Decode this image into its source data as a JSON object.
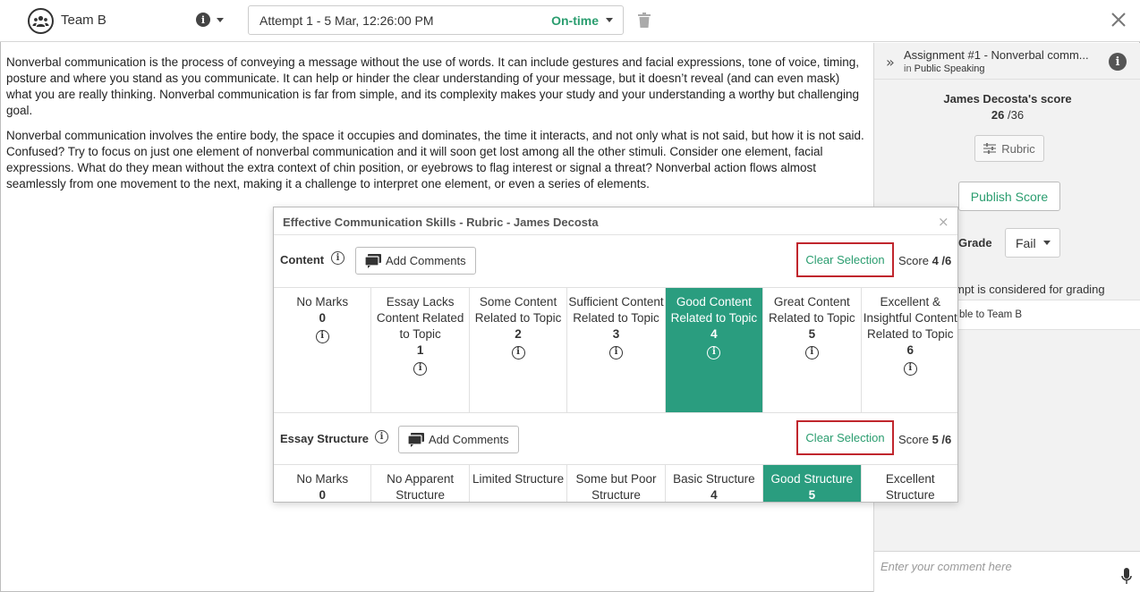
{
  "header": {
    "team_name": "Team B",
    "attempt_label": "Attempt 1 - 5 Mar, 12:26:00 PM",
    "attempt_status": "On-time"
  },
  "essay": {
    "paragraphs": [
      "Nonverbal communication is the process of conveying a message without the use of words. It can include gestures and facial expressions, tone of voice, timing, posture and where you stand as you communicate. It can help or hinder the clear understanding of your message, but it doesn’t reveal (and can even mask) what you are really thinking. Nonverbal communication is far from simple, and its complexity makes your study and your understanding a worthy but challenging goal.",
      "Nonverbal communication involves the entire body, the space it occupies and dominates, the time it interacts, and not only what is not said, but how it is not said. Confused? Try to focus on just one element of nonverbal communication and it will soon get lost among all the other stimuli. Consider one element, facial expressions. What do they mean without the extra context of chin position, or eyebrows to flag interest or signal a threat? Nonverbal action flows almost seamlessly from one movement to the next, making it a challenge to interpret one element, or even a series of elements."
    ]
  },
  "panel": {
    "assignment_title": "Assignment #1 - Nonverbal comm...",
    "assignment_in": "in",
    "assignment_course": "Public Speaking",
    "score_heading": "James Decosta's score",
    "score_value": "26",
    "score_total": "/36",
    "rubric_label": "Rubric",
    "publish_label": "Publish Score",
    "grade_label": "Grade",
    "grade_value": "Fail",
    "attempt_note": "mpt is considered for grading",
    "visible_to": "ble to Team B",
    "comment_placeholder": "Enter your comment here"
  },
  "modal": {
    "title": "Effective Communication Skills - Rubric - James Decosta",
    "add_comments_label": "Add Comments",
    "clear_selection_label": "Clear Selection",
    "score_word": "Score",
    "criteria": [
      {
        "name": "Content",
        "score": "4 /6",
        "levels": [
          {
            "label": "No Marks",
            "points": "0",
            "selected": false
          },
          {
            "label": "Essay Lacks Content Related to Topic",
            "points": "1",
            "selected": false
          },
          {
            "label": "Some Content Related to Topic",
            "points": "2",
            "selected": false
          },
          {
            "label": "Sufficient Content Related to Topic",
            "points": "3",
            "selected": false
          },
          {
            "label": "Good Content Related to Topic",
            "points": "4",
            "selected": true
          },
          {
            "label": "Great Content Related to Topic",
            "points": "5",
            "selected": false
          },
          {
            "label": "Excellent & Insightful Content Related to Topic",
            "points": "6",
            "selected": false
          }
        ]
      },
      {
        "name": "Essay Structure",
        "score": "5 /6",
        "levels": [
          {
            "label": "No Marks",
            "points": "0",
            "selected": false
          },
          {
            "label": "No Apparent Structure",
            "points": "",
            "selected": false
          },
          {
            "label": "Limited Structure",
            "points": "",
            "selected": false
          },
          {
            "label": "Some but Poor Structure",
            "points": "",
            "selected": false
          },
          {
            "label": "Basic Structure",
            "points": "4",
            "selected": false
          },
          {
            "label": "Good Structure",
            "points": "5",
            "selected": true
          },
          {
            "label": "Excellent Structure",
            "points": "",
            "selected": false
          }
        ]
      }
    ]
  }
}
